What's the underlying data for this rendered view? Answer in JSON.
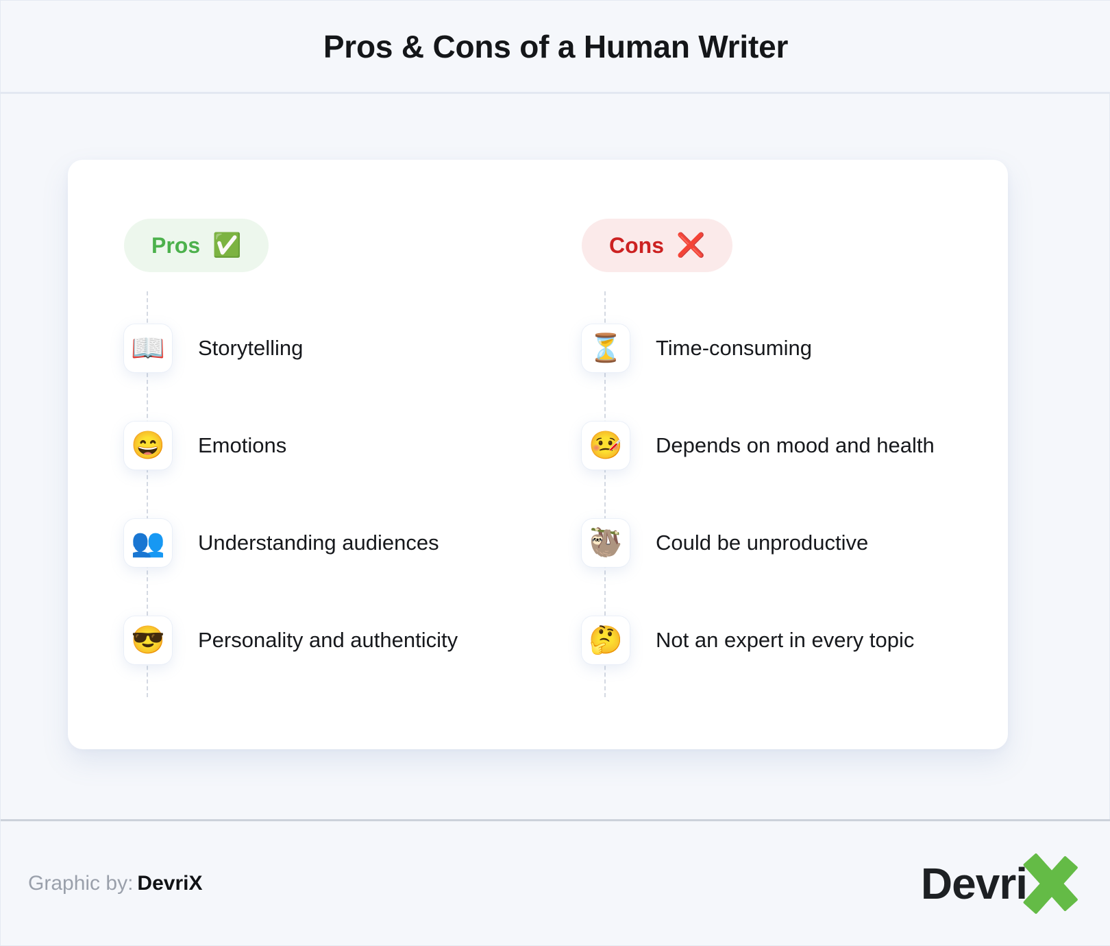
{
  "header": {
    "title": "Pros & Cons of a Human Writer"
  },
  "colors": {
    "page_background": "#f5f7fb",
    "card_background": "#ffffff",
    "pros_accent": "#4cb14c",
    "pros_badge_background": "#edf7ed",
    "cons_accent": "#cc2222",
    "cons_badge_background": "#fbeaea",
    "text": "#16181c",
    "muted_text": "#9aa0ab",
    "divider": "#e3e8f1",
    "timeline_dash": "#d4d9e2",
    "logo_green": "#64bb46",
    "logo_dark": "#1d2023"
  },
  "columns": [
    {
      "key": "pros",
      "badge_label": "Pros",
      "badge_emoji": "✅",
      "badge_icon_name": "check-mark-button-icon",
      "items": [
        {
          "emoji": "📖",
          "icon_name": "open-book-icon",
          "label": "Storytelling"
        },
        {
          "emoji": "😄",
          "icon_name": "grinning-face-icon",
          "label": "Emotions"
        },
        {
          "emoji": "👥",
          "icon_name": "busts-in-silhouette-icon",
          "label": "Understanding audiences"
        },
        {
          "emoji": "😎",
          "icon_name": "smiling-face-with-sunglasses-icon",
          "label": "Personality and authenticity"
        }
      ]
    },
    {
      "key": "cons",
      "badge_label": "Cons",
      "badge_emoji": "❌",
      "badge_icon_name": "cross-mark-icon",
      "items": [
        {
          "emoji": "⏳",
          "icon_name": "hourglass-icon",
          "label": "Time-consuming"
        },
        {
          "emoji": "🤒",
          "icon_name": "face-with-thermometer-icon",
          "label": "Depends on mood and health"
        },
        {
          "emoji": "🦥",
          "icon_name": "sloth-icon",
          "label": "Could be unproductive"
        },
        {
          "emoji": "🤔",
          "icon_name": "thinking-face-icon",
          "label": "Not an expert in every topic"
        }
      ]
    }
  ],
  "footer": {
    "credit_label": "Graphic by:",
    "credit_name": "DevriX",
    "logo_text": "Devri",
    "logo_mark": "X"
  }
}
